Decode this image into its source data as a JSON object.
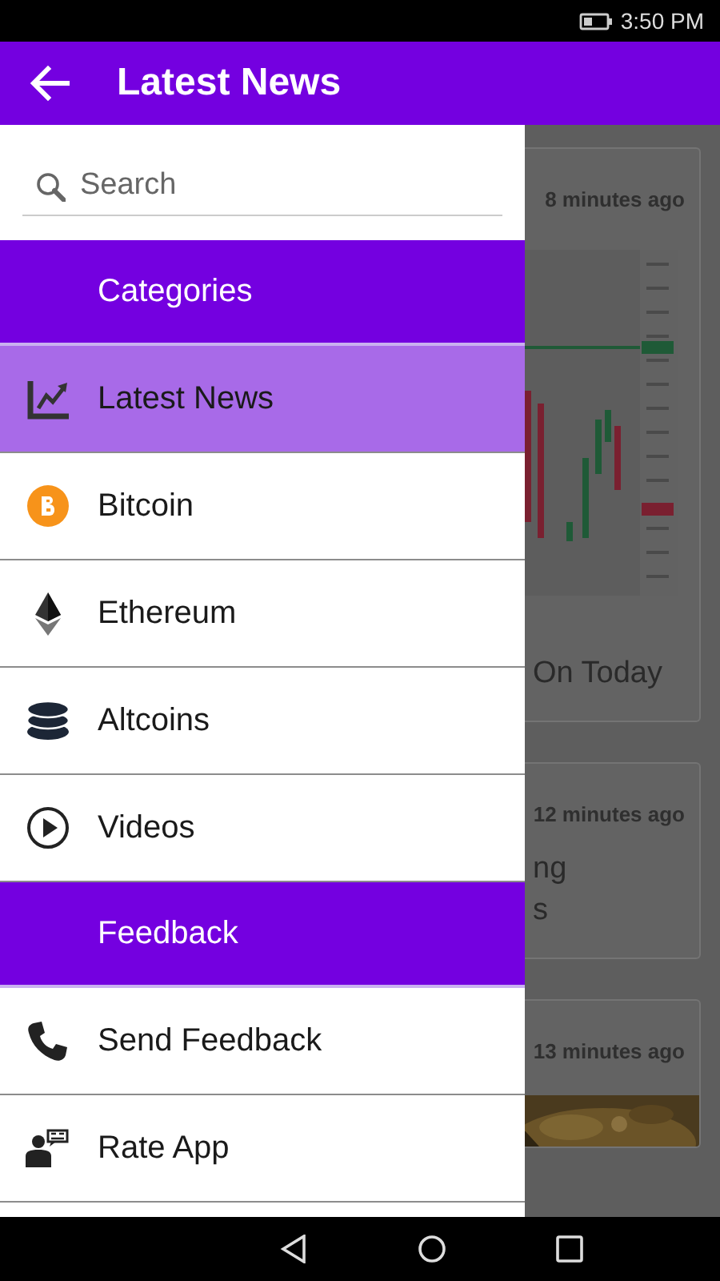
{
  "status_bar": {
    "time": "3:50 PM"
  },
  "app_bar": {
    "title": "Latest News"
  },
  "feed": {
    "cards": [
      {
        "time": "8 minutes ago",
        "lines": [
          "On Today"
        ]
      },
      {
        "time": "12 minutes ago",
        "lines": [
          "ng",
          "s"
        ]
      },
      {
        "time": "13 minutes ago"
      }
    ]
  },
  "drawer": {
    "search": {
      "placeholder": "Search"
    },
    "sections": [
      {
        "title": "Categories",
        "items": [
          {
            "label": "Latest News",
            "selected": true
          },
          {
            "label": "Bitcoin",
            "selected": false
          },
          {
            "label": "Ethereum",
            "selected": false
          },
          {
            "label": "Altcoins",
            "selected": false
          },
          {
            "label": "Videos",
            "selected": false
          }
        ]
      },
      {
        "title": "Feedback",
        "items": [
          {
            "label": "Send Feedback",
            "selected": false
          },
          {
            "label": "Rate App",
            "selected": false
          }
        ]
      }
    ]
  }
}
